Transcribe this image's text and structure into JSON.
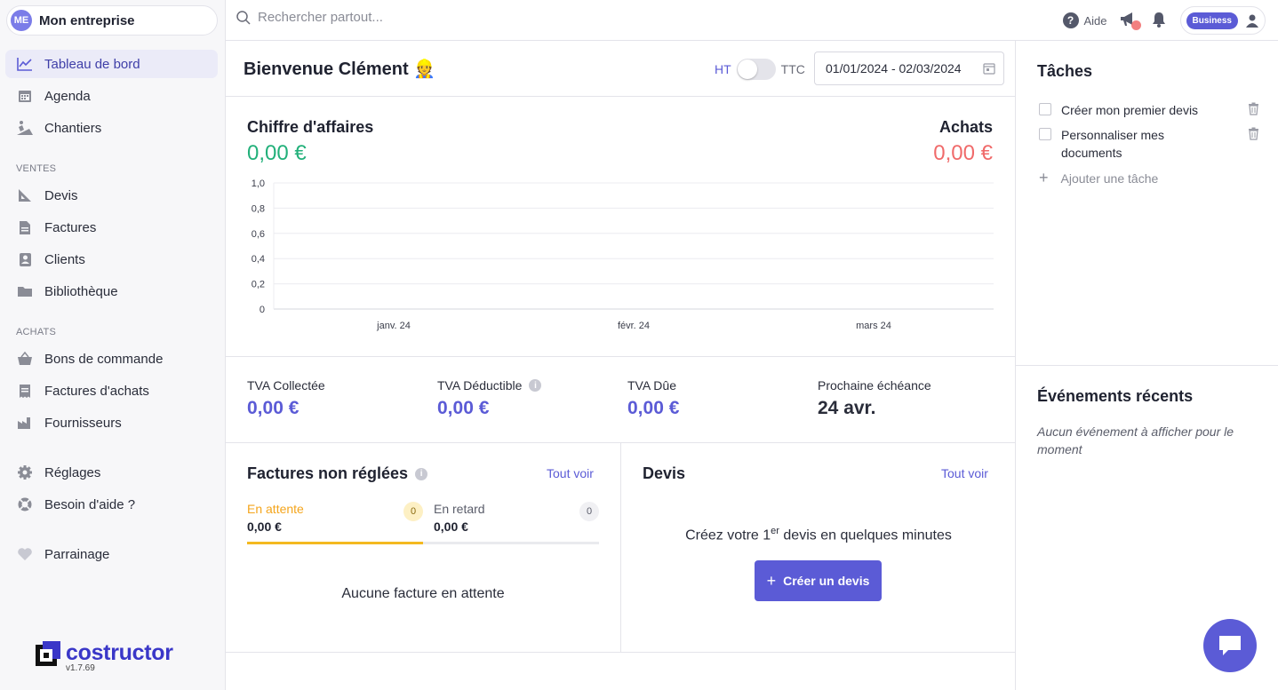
{
  "company": {
    "initials": "ME",
    "name": "Mon entreprise"
  },
  "sidebar": {
    "items": [
      {
        "label": "Tableau de bord",
        "icon": "chart-line-icon"
      },
      {
        "label": "Agenda",
        "icon": "calendar-icon"
      },
      {
        "label": "Chantiers",
        "icon": "construction-icon"
      }
    ],
    "sections": {
      "ventes": {
        "label": "VENTES",
        "items": [
          {
            "label": "Devis",
            "icon": "ruler-icon"
          },
          {
            "label": "Factures",
            "icon": "invoice-icon"
          },
          {
            "label": "Clients",
            "icon": "client-icon"
          },
          {
            "label": "Bibliothèque",
            "icon": "folder-icon"
          }
        ]
      },
      "achats": {
        "label": "ACHATS",
        "items": [
          {
            "label": "Bons de commande",
            "icon": "basket-icon"
          },
          {
            "label": "Factures d'achats",
            "icon": "receipt-icon"
          },
          {
            "label": "Fournisseurs",
            "icon": "factory-icon"
          }
        ]
      }
    },
    "bottom": [
      {
        "label": "Réglages",
        "icon": "gear-icon"
      },
      {
        "label": "Besoin d'aide ?",
        "icon": "lifebuoy-icon"
      },
      {
        "label": "Parrainage",
        "icon": "heart-icon"
      }
    ],
    "brand": {
      "name": "costructor",
      "version": "v1.7.69"
    }
  },
  "topbar": {
    "search_placeholder": "Rechercher partout...",
    "help_label": "Aide",
    "plan_badge": "Business"
  },
  "header": {
    "welcome": "Bienvenue Clément 👷",
    "toggle_left": "HT",
    "toggle_right": "TTC",
    "date_range": "01/01/2024 - 02/03/2024"
  },
  "revenue": {
    "title": "Chiffre d'affaires",
    "value": "0,00 €"
  },
  "purchases": {
    "title": "Achats",
    "value": "0,00 €"
  },
  "chart_data": {
    "type": "line",
    "x": [
      "janv. 24",
      "févr. 24",
      "mars 24"
    ],
    "series": [],
    "ylim": [
      0,
      1.0
    ],
    "yticks": [
      "0",
      "0,2",
      "0,4",
      "0,6",
      "0,8",
      "1,0"
    ],
    "grid": true
  },
  "vat": [
    {
      "label": "TVA Collectée",
      "value": "0,00 €"
    },
    {
      "label": "TVA Déductible",
      "value": "0,00 €"
    },
    {
      "label": "TVA Dûe",
      "value": "0,00 €"
    },
    {
      "label": "Prochaine échéance",
      "value": "24 avr."
    }
  ],
  "unpaid": {
    "title": "Factures non réglées",
    "see_all": "Tout voir",
    "tabs": [
      {
        "label": "En attente",
        "value": "0,00 €",
        "count": "0"
      },
      {
        "label": "En retard",
        "value": "0,00 €",
        "count": "0"
      }
    ],
    "empty": "Aucune facture en attente"
  },
  "quotes": {
    "title": "Devis",
    "see_all": "Tout voir",
    "msg_pre": "Créez votre 1",
    "msg_sup": "er",
    "msg_post": " devis en quelques minutes",
    "button": "Créer un devis"
  },
  "tasks": {
    "title": "Tâches",
    "items": [
      "Créer mon premier devis",
      "Personnaliser mes documents"
    ],
    "add_label": "Ajouter une tâche"
  },
  "events": {
    "title": "Événements récents",
    "empty": "Aucun événement à afficher pour le moment"
  },
  "colors": {
    "accent": "#5b5bd6",
    "positive": "#22b07a",
    "negative": "#f06a6a",
    "pending": "#f4b920"
  }
}
